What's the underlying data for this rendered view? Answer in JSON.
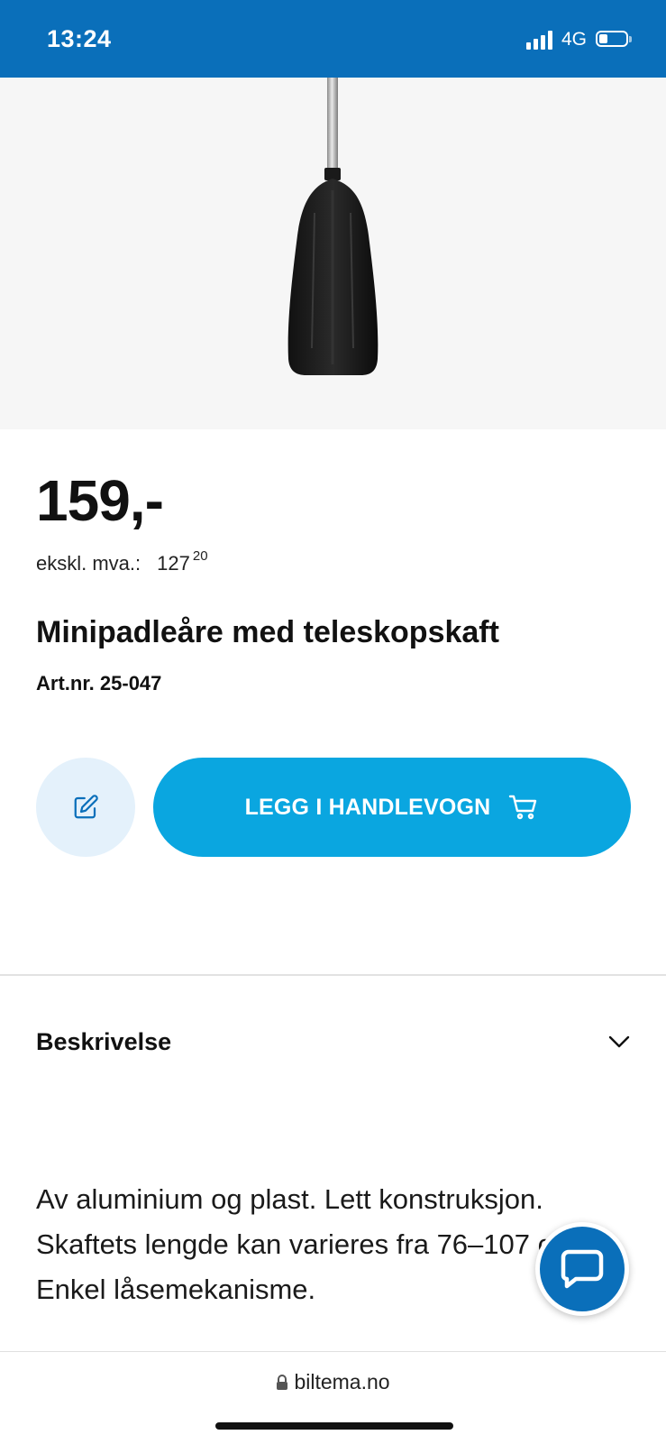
{
  "status_bar": {
    "time": "13:24",
    "network": "4G",
    "bg_color": "#0a6fba",
    "battery_level": 0.25,
    "signal_bars": 4
  },
  "product": {
    "price": "159,-",
    "vat_label": "ekskl. mva.:",
    "vat_value": "127",
    "vat_cents": "20",
    "title": "Minipadleåre med teleskopskaft",
    "art_nr": "Art.nr. 25-047",
    "image_icon": "paddle-image"
  },
  "actions": {
    "note_icon": "edit-note-icon",
    "cart_label": "LEGG I HANDLEVOGN",
    "cart_icon": "cart-icon",
    "cart_color": "#0aa6e0",
    "note_bg": "#e4f1fb"
  },
  "description": {
    "title": "Beskrivelse",
    "toggle_icon": "chevron-down-icon",
    "lines": [
      "Av aluminium og plast. Lett konstruksjon.",
      "Skaftets lengde kan varieres fra 76–107 cm.",
      "Enkel låsemekanisme."
    ]
  },
  "chat": {
    "icon": "chat-bubble-icon"
  },
  "browser": {
    "url": "biltema.no",
    "lock_icon": "lock-icon"
  }
}
